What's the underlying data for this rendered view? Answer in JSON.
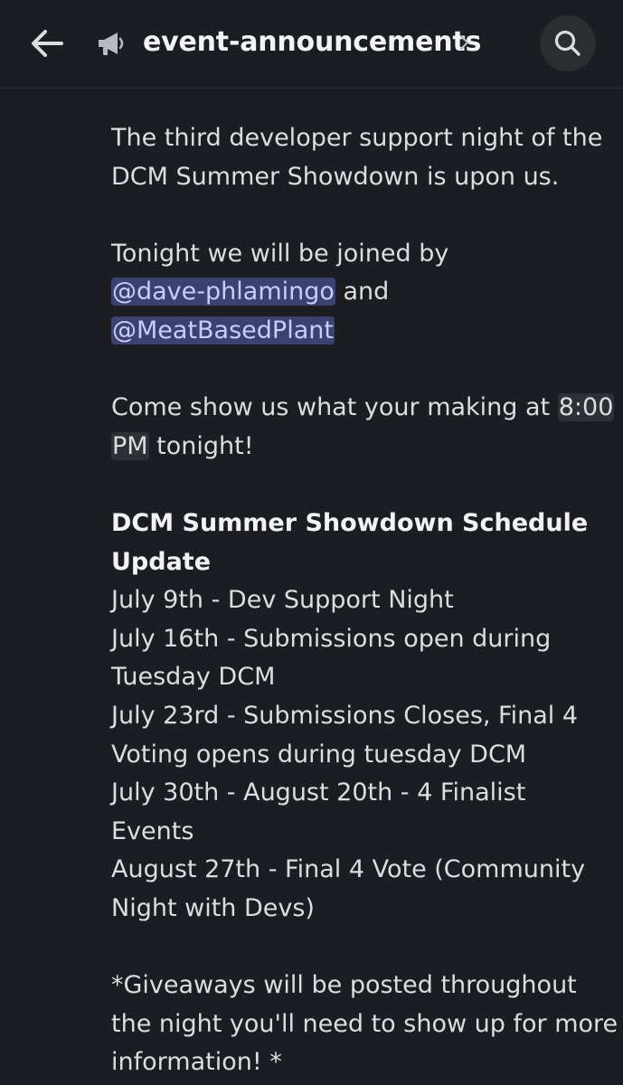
{
  "header": {
    "channel_name": "event-announcements",
    "back_icon": "arrow-left-icon",
    "channel_icon": "megaphone-icon",
    "chevron_icon": "chevron-right-icon",
    "search_icon": "search-icon"
  },
  "message": {
    "intro": [
      "The third developer support night of the",
      "DCM Summer Showdown is upon us."
    ],
    "joined_text": "Tonight we will be joined by",
    "mention_1": "@dave-phlamingo",
    "and_text": " and",
    "mention_2": "@MeatBasedPlant",
    "come_text": "Come show us what your making at ",
    "time_part_1": "8:00",
    "time_part_2": "PM",
    "tonight_text": " tonight!",
    "schedule_heading": [
      "DCM Summer Showdown Schedule",
      "Update"
    ],
    "schedule_lines": [
      "July 9th - Dev Support Night",
      "July 16th - Submissions open during",
      "Tuesday DCM",
      "July 23rd - Submissions Closes, Final 4",
      "Voting opens during tuesday DCM",
      "July 30th - August 20th -  4 Finalist",
      "Events",
      "August 27th - Final 4 Vote (Community",
      "Night with Devs)"
    ],
    "giveaway_lines": [
      "*Giveaways will be posted throughout",
      "the night you'll need to show up for more",
      "information! *"
    ]
  },
  "colors": {
    "background": "#1c1d22",
    "text": "#dbdee1",
    "mention_bg": "#3c4270",
    "mention_text": "#c9cdfb",
    "timestamp_bg": "#2e3035"
  }
}
